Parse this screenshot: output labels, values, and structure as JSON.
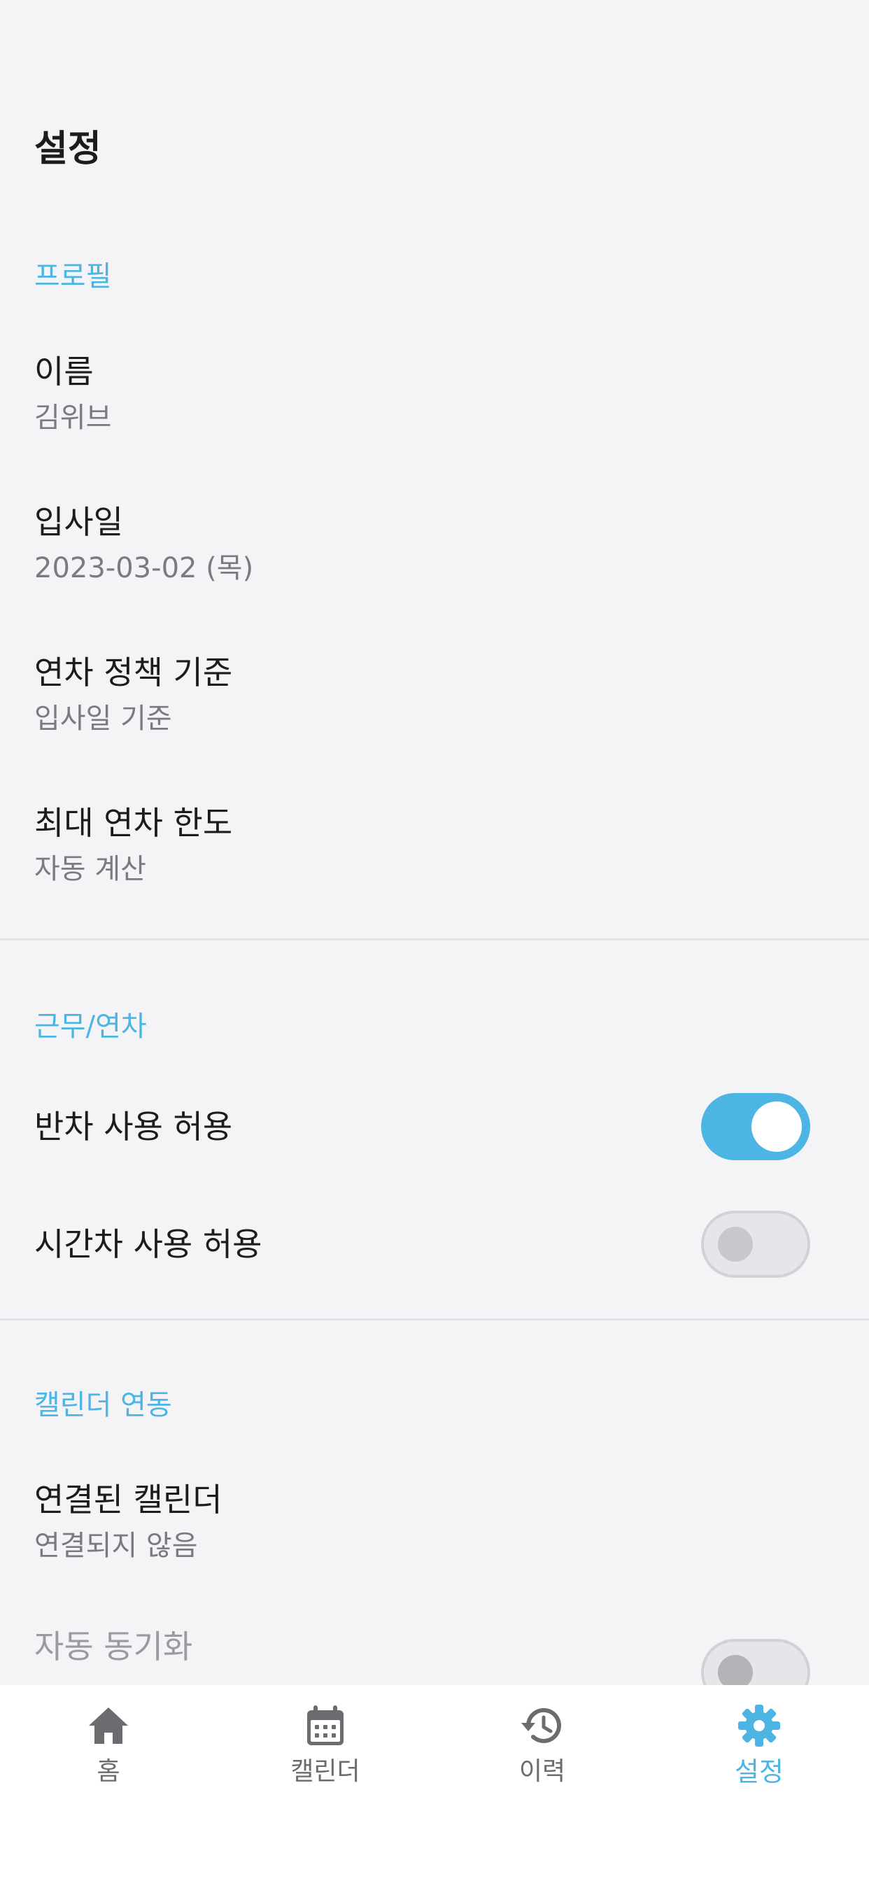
{
  "page": {
    "title": "설정"
  },
  "sections": {
    "profile": {
      "header": "프로필",
      "name": {
        "label": "이름",
        "value": "김위브"
      },
      "hire_date": {
        "label": "입사일",
        "value": "2023-03-02 (목)"
      },
      "policy": {
        "label": "연차 정책 기준",
        "value": "입사일 기준"
      },
      "max_leave": {
        "label": "최대 연차 한도",
        "value": "자동 계산"
      }
    },
    "work": {
      "header": "근무/연차",
      "half_day": {
        "label": "반차 사용 허용",
        "enabled": true
      },
      "hourly": {
        "label": "시간차 사용 허용",
        "enabled": false
      }
    },
    "calendar": {
      "header": "캘린더 연동",
      "linked": {
        "label": "연결된 캘린더",
        "value": "연결되지 않음"
      },
      "auto_sync": {
        "label": "자동 동기화",
        "enabled": false
      }
    }
  },
  "tabbar": {
    "items": [
      {
        "label": "홈",
        "icon": "home-icon",
        "active": false
      },
      {
        "label": "캘린더",
        "icon": "calendar-icon",
        "active": false
      },
      {
        "label": "이력",
        "icon": "history-icon",
        "active": false
      },
      {
        "label": "설정",
        "icon": "gear-icon",
        "active": true
      }
    ]
  },
  "colors": {
    "accent": "#4db5e3",
    "background": "#f4f4f6",
    "tabbar": "#ffffff",
    "text_primary": "#1c1c1e",
    "text_secondary": "#7a7a80"
  }
}
